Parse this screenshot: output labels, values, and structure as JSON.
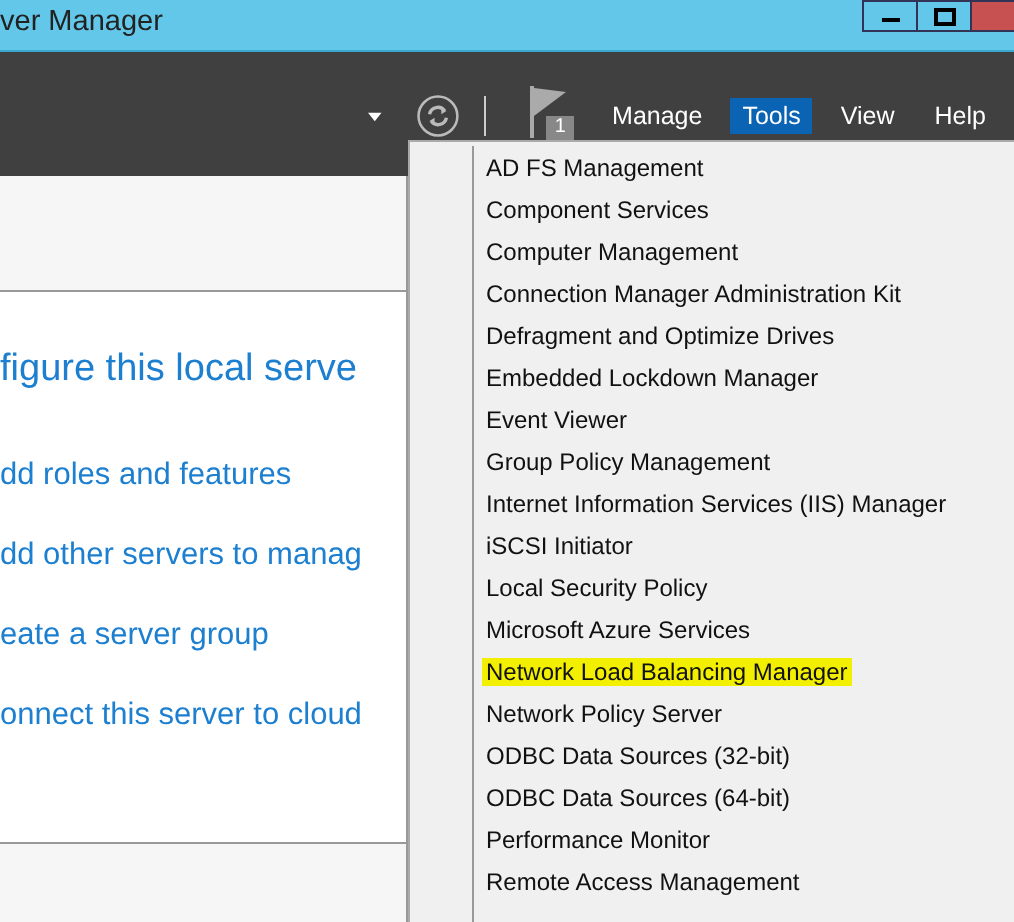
{
  "window": {
    "title": "ver Manager"
  },
  "toolbar": {
    "notification_count": "1",
    "menus": [
      {
        "label": "Manage",
        "selected": false
      },
      {
        "label": "Tools",
        "selected": true
      },
      {
        "label": "View",
        "selected": false
      },
      {
        "label": "Help",
        "selected": false
      }
    ]
  },
  "welcome": {
    "heading": "figure this local serve",
    "links": [
      "dd roles and features",
      "dd other servers to manag",
      "eate a server group",
      "onnect this server to cloud"
    ]
  },
  "tools_menu": {
    "items": [
      {
        "label": "AD FS Management",
        "highlighted": false
      },
      {
        "label": "Component Services",
        "highlighted": false
      },
      {
        "label": "Computer Management",
        "highlighted": false
      },
      {
        "label": "Connection Manager Administration Kit",
        "highlighted": false
      },
      {
        "label": "Defragment and Optimize Drives",
        "highlighted": false
      },
      {
        "label": "Embedded Lockdown Manager",
        "highlighted": false
      },
      {
        "label": "Event Viewer",
        "highlighted": false
      },
      {
        "label": "Group Policy Management",
        "highlighted": false
      },
      {
        "label": "Internet Information Services (IIS) Manager",
        "highlighted": false
      },
      {
        "label": "iSCSI Initiator",
        "highlighted": false
      },
      {
        "label": "Local Security Policy",
        "highlighted": false
      },
      {
        "label": "Microsoft Azure Services",
        "highlighted": false
      },
      {
        "label": "Network Load Balancing Manager",
        "highlighted": true
      },
      {
        "label": "Network Policy Server",
        "highlighted": false
      },
      {
        "label": "ODBC Data Sources (32-bit)",
        "highlighted": false
      },
      {
        "label": "ODBC Data Sources (64-bit)",
        "highlighted": false
      },
      {
        "label": "Performance Monitor",
        "highlighted": false
      },
      {
        "label": "Remote Access Management",
        "highlighted": false
      }
    ]
  }
}
